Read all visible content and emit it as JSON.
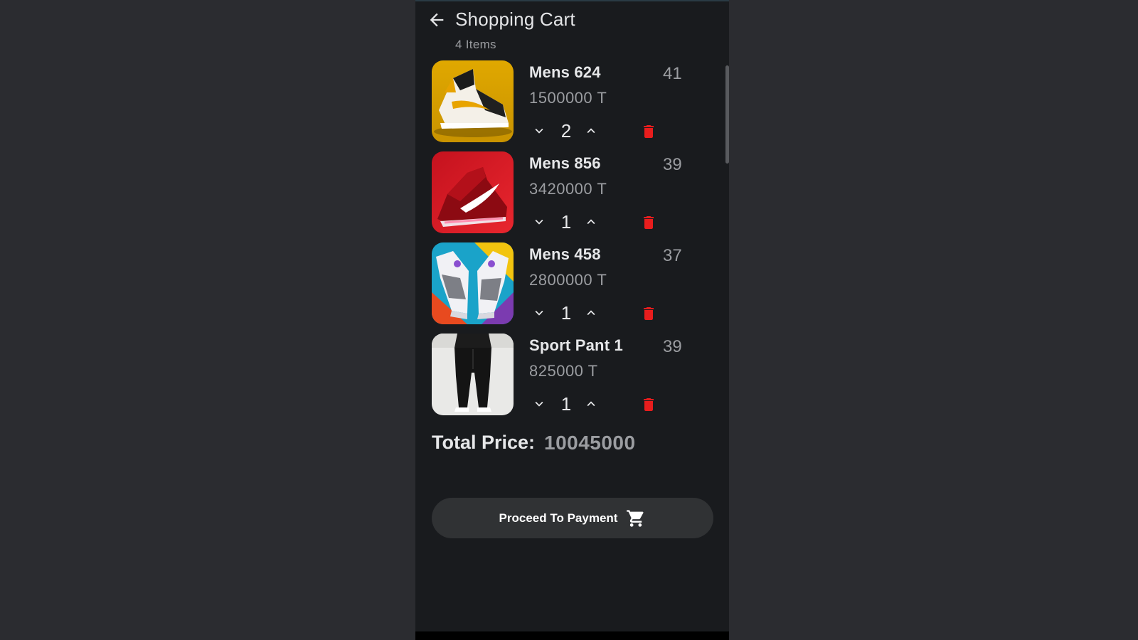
{
  "header": {
    "title": "Shopping Cart",
    "item_count": "4 Items"
  },
  "cart": {
    "items": [
      {
        "name": "Mens 624",
        "price": "1500000 T",
        "size": "41",
        "quantity": "2",
        "image": "yellow-sneaker-photo"
      },
      {
        "name": "Mens 856",
        "price": "3420000 T",
        "size": "39",
        "quantity": "1",
        "image": "red-running-shoe-photo"
      },
      {
        "name": "Mens 458",
        "price": "2800000 T",
        "size": "37",
        "quantity": "1",
        "image": "white-sneakers-colorful-background-photo"
      },
      {
        "name": "Sport Pant 1",
        "price": "825000 T",
        "size": "39",
        "quantity": "1",
        "image": "black-sport-pants-photo"
      }
    ]
  },
  "summary": {
    "total_label": "Total Price:",
    "total_value": "10045000"
  },
  "actions": {
    "pay_label": "Proceed To Payment"
  },
  "icons": {
    "back": "arrow-left-icon",
    "decrease": "chevron-down-icon",
    "increase": "chevron-up-icon",
    "delete": "trash-icon",
    "cart": "shopping-cart-icon"
  },
  "colors": {
    "screen_bg": "#191b1e",
    "outer_bg": "#2b2c30",
    "delete_red": "#e81d1d",
    "button_bg": "#303234"
  }
}
